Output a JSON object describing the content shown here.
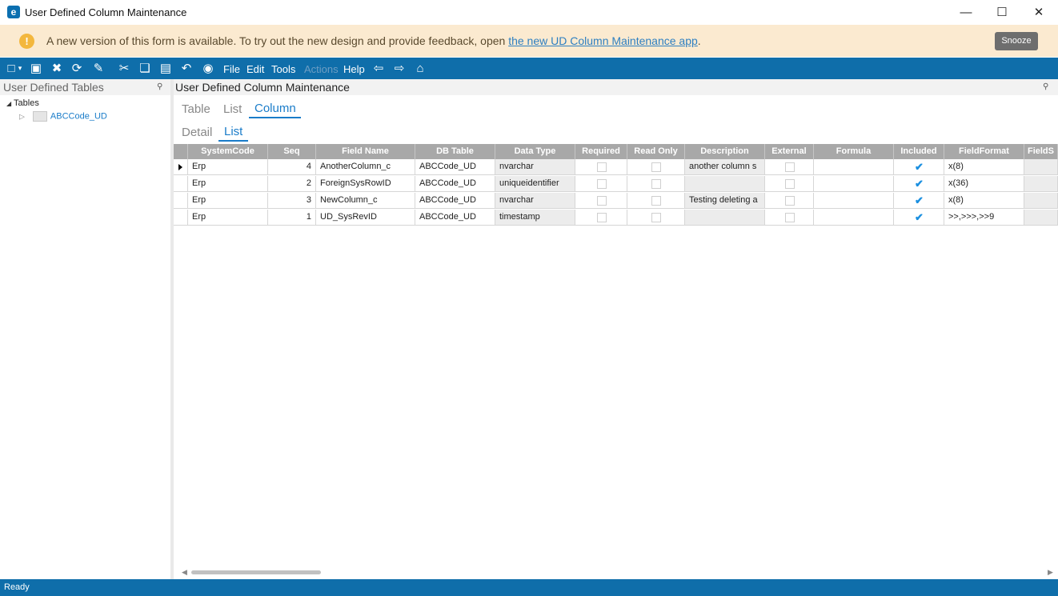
{
  "window": {
    "title": "User Defined Column Maintenance",
    "app_icon": "e"
  },
  "banner": {
    "text": "A new version of this form is available. To try out the new design and provide feedback, open ",
    "link_text": "the new UD Column Maintenance app",
    "trailing": ".",
    "snooze_label": "Snooze",
    "background": "#fbead0"
  },
  "toolbar": {
    "menus": [
      "File",
      "Edit",
      "Tools",
      "Actions",
      "Help"
    ],
    "disabled_menu": "Actions",
    "background": "#0f6eaa"
  },
  "left_panel": {
    "title": "User Defined Tables",
    "tree_root": "Tables",
    "tree_child": "ABCCode_UD"
  },
  "right_panel": {
    "title": "User Defined Column Maintenance"
  },
  "tabs_primary": [
    "Table",
    "List",
    "Column"
  ],
  "tabs_primary_active": "Column",
  "tabs_secondary": [
    "Detail",
    "List"
  ],
  "tabs_secondary_active": "List",
  "grid": {
    "headers": [
      "SystemCode",
      "Seq",
      "Field Name",
      "DB Table",
      "Data Type",
      "Required",
      "Read Only",
      "Description",
      "External",
      "Formula",
      "Included",
      "FieldFormat",
      "FieldS"
    ],
    "rows": [
      {
        "system_code": "Erp",
        "seq": "4",
        "field_name": "AnotherColumn_c",
        "db_table": "ABCCode_UD",
        "data_type": "nvarchar",
        "required": false,
        "read_only": false,
        "description": "another column s",
        "external": false,
        "formula": "",
        "included": true,
        "field_format": "x(8)"
      },
      {
        "system_code": "Erp",
        "seq": "2",
        "field_name": "ForeignSysRowID",
        "db_table": "ABCCode_UD",
        "data_type": "uniqueidentifier",
        "required": false,
        "read_only": false,
        "description": "",
        "external": false,
        "formula": "",
        "included": true,
        "field_format": "x(36)"
      },
      {
        "system_code": "Erp",
        "seq": "3",
        "field_name": "NewColumn_c",
        "db_table": "ABCCode_UD",
        "data_type": "nvarchar",
        "required": false,
        "read_only": false,
        "description": "Testing deleting a",
        "external": false,
        "formula": "",
        "included": true,
        "field_format": "x(8)"
      },
      {
        "system_code": "Erp",
        "seq": "1",
        "field_name": "UD_SysRevID",
        "db_table": "ABCCode_UD",
        "data_type": "timestamp",
        "required": false,
        "read_only": false,
        "description": "",
        "external": false,
        "formula": "",
        "included": true,
        "field_format": ">>,>>>,>>9"
      }
    ]
  },
  "status": {
    "text": "Ready"
  }
}
